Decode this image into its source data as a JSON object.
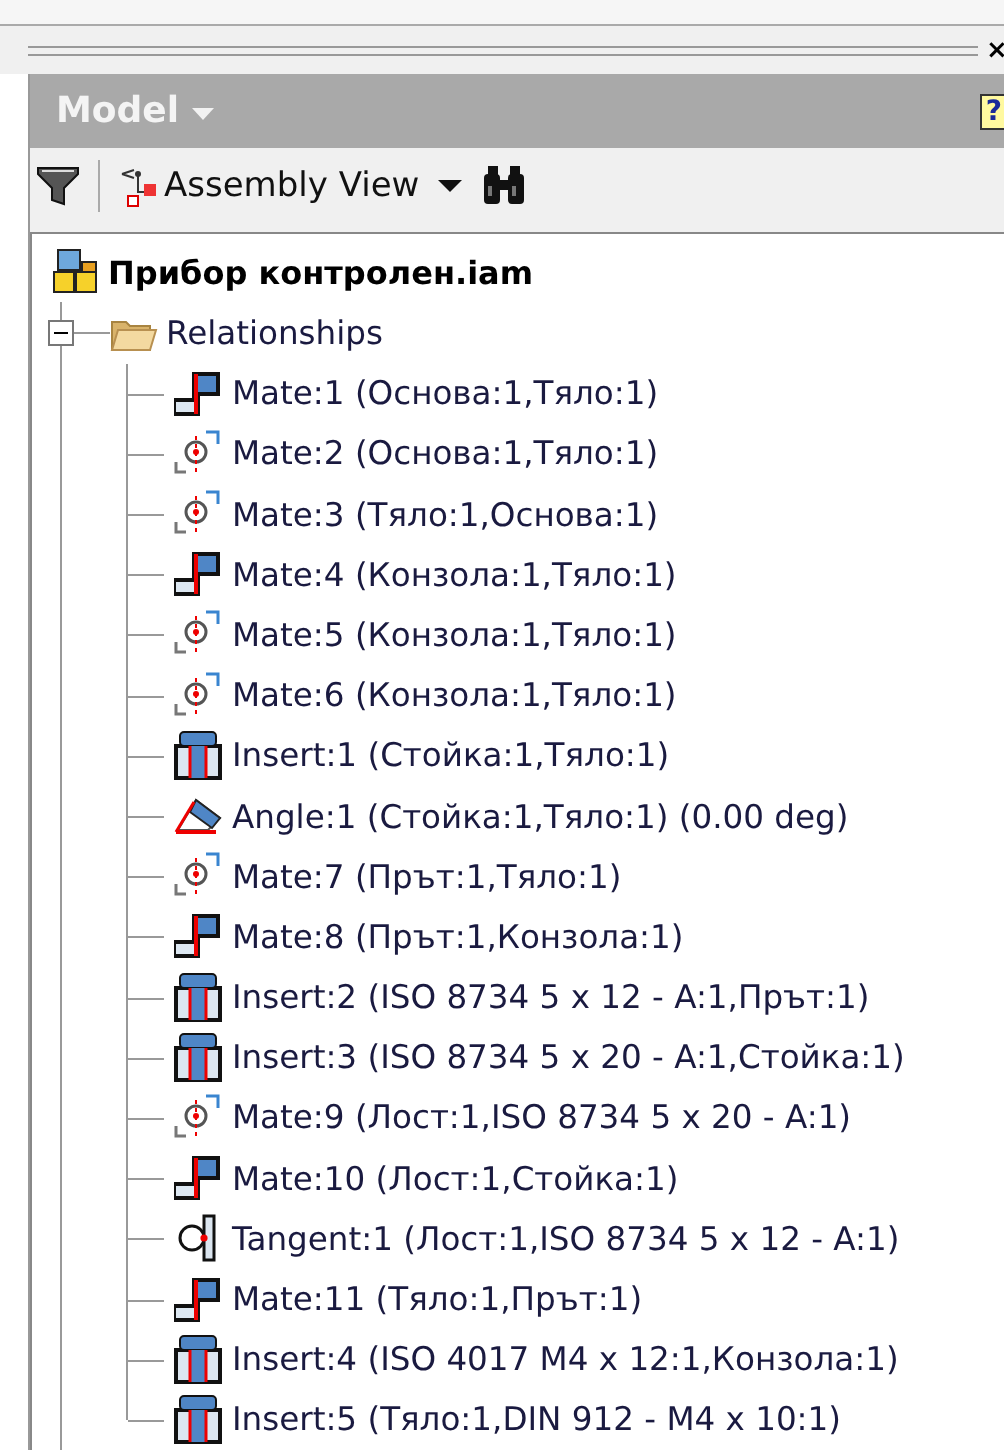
{
  "panel": {
    "close": "×",
    "title": "Model",
    "help": "?"
  },
  "toolbar": {
    "view": "Assembly View"
  },
  "tree": {
    "label": "Прибор контролен.iam",
    "children": [
      {
        "label": "Relationships",
        "expanded": true,
        "children": [
          {
            "kind": "mate",
            "label": "Mate:1 (Основа:1,Тяло:1)"
          },
          {
            "kind": "axis",
            "label": "Mate:2 (Основа:1,Тяло:1)"
          },
          {
            "kind": "axis",
            "label": "Mate:3 (Тяло:1,Основа:1)"
          },
          {
            "kind": "mate",
            "label": "Mate:4 (Конзола:1,Тяло:1)"
          },
          {
            "kind": "axis",
            "label": "Mate:5 (Конзола:1,Тяло:1)"
          },
          {
            "kind": "axis",
            "label": "Mate:6 (Конзола:1,Тяло:1)"
          },
          {
            "kind": "insert",
            "label": "Insert:1 (Стойка:1,Тяло:1)"
          },
          {
            "kind": "angle",
            "label": "Angle:1 (Стойка:1,Тяло:1) (0.00 deg)"
          },
          {
            "kind": "axis",
            "label": "Mate:7 (Прът:1,Тяло:1)"
          },
          {
            "kind": "mate",
            "label": "Mate:8 (Прът:1,Конзола:1)"
          },
          {
            "kind": "insert",
            "label": "Insert:2 (ISO 8734 5 x 12 - A:1,Прът:1)"
          },
          {
            "kind": "insert",
            "label": "Insert:3 (ISO 8734 5 x 20 - A:1,Стойка:1)"
          },
          {
            "kind": "axis",
            "label": "Mate:9 (Лост:1,ISO 8734 5 x 20 - A:1)"
          },
          {
            "kind": "mate",
            "label": "Mate:10 (Лост:1,Стойка:1)"
          },
          {
            "kind": "tangent",
            "label": "Tangent:1 (Лост:1,ISO 8734 5 x 12 - A:1)"
          },
          {
            "kind": "mate",
            "label": "Mate:11 (Тяло:1,Прът:1)"
          },
          {
            "kind": "insert",
            "label": "Insert:4 (ISO 4017 M4 x 12:1,Конзола:1)"
          },
          {
            "kind": "insert",
            "label": "Insert:5 (Тяло:1,DIN 912 -  M4 x 10:1)"
          }
        ]
      }
    ]
  }
}
